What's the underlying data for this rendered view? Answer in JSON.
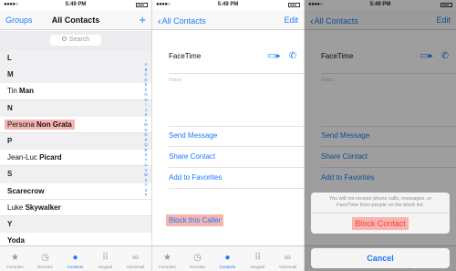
{
  "status": {
    "time": "5:49 PM",
    "signal": "●●●●○"
  },
  "screen1": {
    "nav_left": "Groups",
    "nav_title": "All Contacts",
    "nav_right": "+",
    "search_placeholder": "Search",
    "rows": [
      {
        "type": "section",
        "pre": "L",
        "bold": ""
      },
      {
        "type": "section",
        "pre": "M",
        "bold": ""
      },
      {
        "type": "contact",
        "pre": "Tin ",
        "bold": "Man"
      },
      {
        "type": "section",
        "pre": "N",
        "bold": ""
      },
      {
        "type": "contact",
        "pre": "Persona ",
        "bold": "Non Grata"
      },
      {
        "type": "section",
        "pre": "P",
        "bold": ""
      },
      {
        "type": "contact",
        "pre": "Jean-Luc ",
        "bold": "Picard"
      },
      {
        "type": "section",
        "pre": "S",
        "bold": ""
      },
      {
        "type": "contact",
        "pre": "",
        "bold": "Scarecrow"
      },
      {
        "type": "contact",
        "pre": "Luke ",
        "bold": "Skywalker"
      },
      {
        "type": "section",
        "pre": "Y",
        "bold": ""
      },
      {
        "type": "contact",
        "pre": "",
        "bold": "Yoda"
      }
    ],
    "index_letters": [
      "A",
      "B",
      "C",
      "D",
      "E",
      "F",
      "G",
      "H",
      "I",
      "J",
      "K",
      "L",
      "M",
      "N",
      "O",
      "P",
      "Q",
      "R",
      "S",
      "T",
      "U",
      "V",
      "W",
      "X",
      "Y",
      "Z",
      "#"
    ],
    "tabs": [
      {
        "label": "Favorites",
        "icon": "★",
        "name": "favorites"
      },
      {
        "label": "Recents",
        "icon": "◷",
        "name": "recents"
      },
      {
        "label": "Contacts",
        "icon": "●",
        "name": "contacts"
      },
      {
        "label": "Keypad",
        "icon": "⠿",
        "name": "keypad"
      },
      {
        "label": "Voicemail",
        "icon": "∞",
        "name": "voicemail"
      }
    ]
  },
  "screen2": {
    "nav_back": "All Contacts",
    "nav_right": "Edit",
    "facetime": "FaceTime",
    "notes": "Notes",
    "send_message": "Send Message",
    "share_contact": "Share Contact",
    "add_favorites": "Add to Favorites",
    "block_caller": "Block this Caller"
  },
  "screen3": {
    "sheet_message": "You will not receive phone calls, messages, or FaceTime from people on the block list.",
    "block_contact": "Block Contact",
    "cancel": "Cancel"
  },
  "colors": {
    "accent": "#1a7cf5",
    "highlight": "#f7b5b2",
    "destructive": "#ff3b30"
  }
}
